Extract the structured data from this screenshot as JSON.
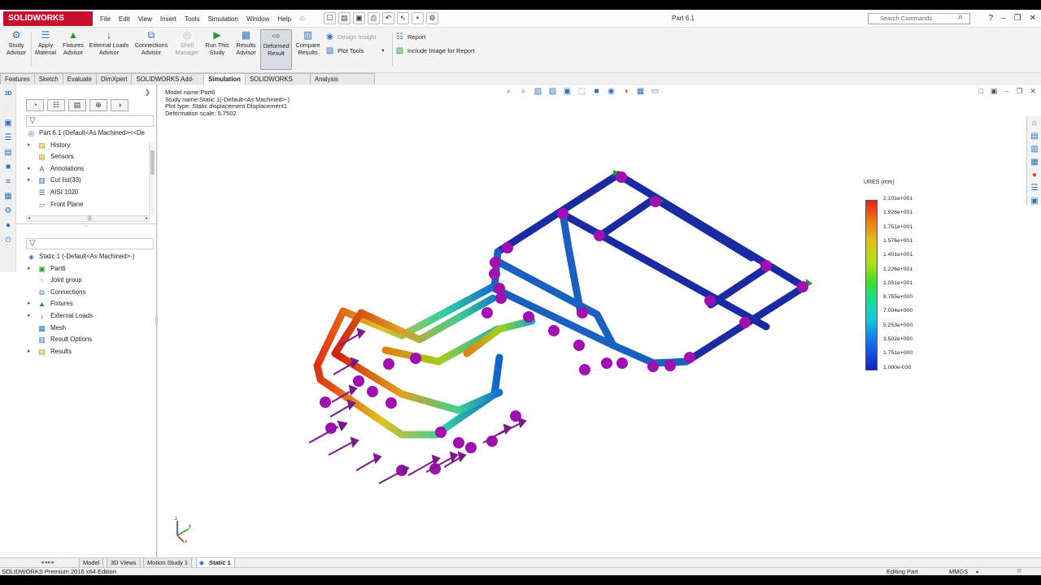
{
  "app": {
    "logo": "SOLIDWORKS",
    "doc_title": "Part 6.1"
  },
  "menu": [
    "File",
    "Edit",
    "View",
    "Insert",
    "Tools",
    "Simulation",
    "Window",
    "Help"
  ],
  "search": {
    "placeholder": "Search Commands"
  },
  "ribbon": {
    "study_advisor": "Study\nAdvisor",
    "apply_material": "Apply\nMaterial",
    "fixtures_advisor": "Fixtures\nAdvisor",
    "external_loads_advisor": "External Loads\nAdvisor",
    "connections_advisor": "Connections\nAdvisor",
    "shell_manager": "Shell\nManager",
    "run_this_study": "Run This\nStudy",
    "results_advisor": "Results\nAdvisor",
    "deformed_result": "Deformed\nResult",
    "compare_results": "Compare\nResults",
    "design_insight": "Design Insight",
    "plot_tools": "Plot Tools",
    "report": "Report",
    "include_image": "Include Image for Report"
  },
  "tabs": [
    {
      "label": "Features"
    },
    {
      "label": "Sketch"
    },
    {
      "label": "Evaluate"
    },
    {
      "label": "DimXpert"
    },
    {
      "label": "SOLIDWORKS Add-Ins"
    },
    {
      "label": "Simulation"
    },
    {
      "label": "SOLIDWORKS MBD"
    },
    {
      "label": "Analysis Preparation"
    }
  ],
  "feature_tree": {
    "root": "Part 6.1  (Default<As Machined><<De",
    "items": [
      "History",
      "Sensors",
      "Annotations",
      "Cut list(33)",
      "AISI 1020",
      "Front Plane"
    ]
  },
  "study_tree": {
    "root": "Static 1 (-Default<As Machined>-)",
    "items": [
      "Part6",
      "Joint group",
      "Connections",
      "Fixtures",
      "External Loads",
      "Mesh",
      "Result Options",
      "Results"
    ]
  },
  "model_info": {
    "line1": "Model name:Part6",
    "line2": "Study name:Static 1(-Default<As Machined>-)",
    "line3": "Plot type: Static displacement Displacement1",
    "line4": "Deformation scale: 5.7502"
  },
  "legend": {
    "title": "URES (mm)",
    "labels": [
      "2.101e+001",
      "1.926e+001",
      "1.751e+001",
      "1.576e+001",
      "1.401e+001",
      "1.226e+001",
      "1.051e+001",
      "8.755e+000",
      "7.004e+000",
      "5.253e+000",
      "3.502e+000",
      "1.751e+000",
      "1.000e-030"
    ]
  },
  "triad": {
    "x": "x",
    "y": "y",
    "z": "z"
  },
  "bottom_tabs": [
    "Model",
    "3D Views",
    "Motion Study 1",
    "Static 1"
  ],
  "status": {
    "edition": "SOLIDWORKS Premium 2016 x64 Edition",
    "mode": "Editing Part",
    "units": "MMGS"
  },
  "colors": {
    "brand_red": "#c8102e",
    "load_arrow": "#7a1a8a",
    "fixture_green": "#1a9a2a"
  }
}
